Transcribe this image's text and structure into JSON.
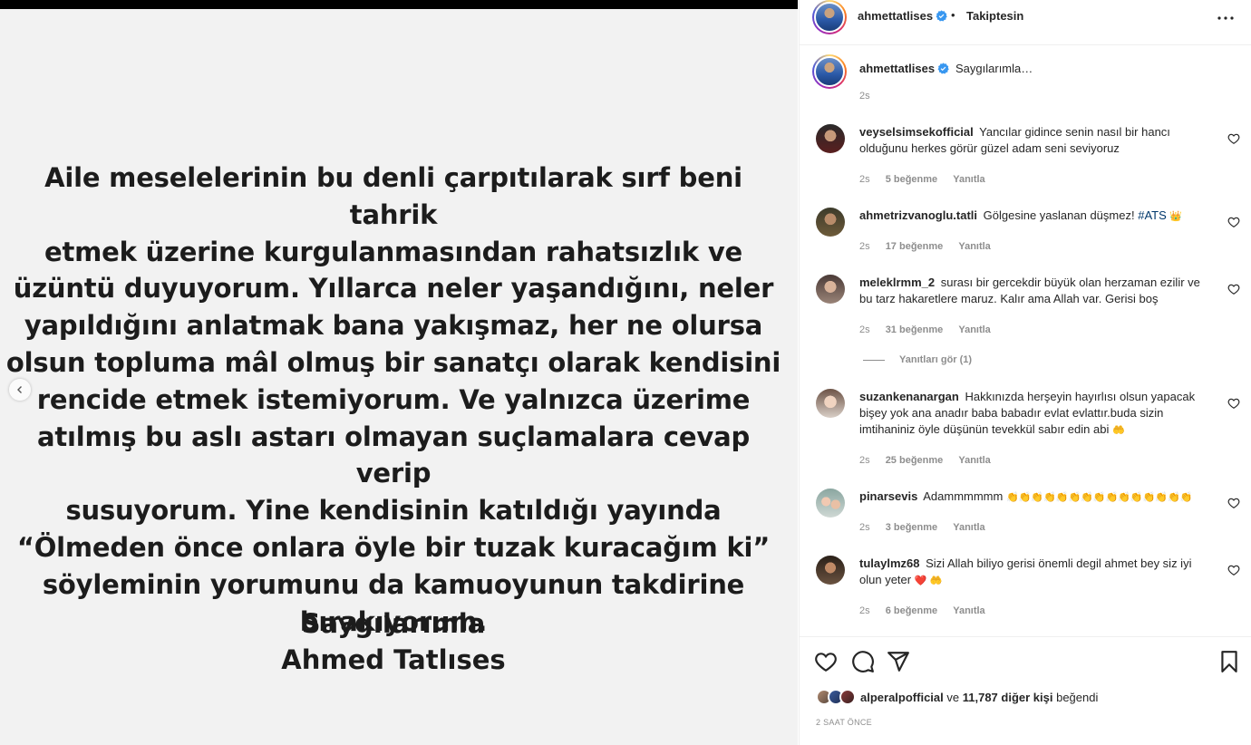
{
  "post": {
    "text_lines": [
      "Aile meselelerinin bu denli çarpıtılarak sırf beni tahrik",
      "etmek üzerine kurgulanmasından rahatsızlık ve",
      "üzüntü duyuyorum. Yıllarca neler yaşandığını, neler",
      "yapıldığını anlatmak bana yakışmaz, her ne olursa",
      "olsun topluma mâl olmuş bir sanatçı olarak kendisini",
      "rencide etmek istemiyorum. Ve yalnızca üzerime",
      "atılmış bu aslı astarı olmayan suçlamalara cevap verip",
      "susuyorum. Yine kendisinin katıldığı yayında",
      "“Ölmeden önce onlara öyle bir tuzak kuracağım ki”",
      "söyleminin yorumunu da kamuoyunun takdirine",
      "bırakıyorum."
    ],
    "sign_1": "Saygılarımla",
    "sign_2": "Ahmed Tatlıses"
  },
  "header": {
    "username": "ahmettatlises",
    "dot": "•",
    "follow_status": "Takiptesin"
  },
  "caption": {
    "username": "ahmettatlises",
    "text": "Saygılarımla…",
    "time": "2s"
  },
  "comments": [
    {
      "user": "veyselsimsekofficial",
      "text": "Yancılar gidince senin nasıl bir hancı olduğunu herkes görür güzel adam seni seviyoruz",
      "time": "2s",
      "likes": "5 beğenme",
      "reply": "Yanıtla"
    },
    {
      "user": "ahmetrizvanoglu.tatli",
      "text": "Gölgesine yaslanan düşmez!",
      "tag": "#ATS",
      "emoji": "👑",
      "time": "2s",
      "likes": "17 beğenme",
      "reply": "Yanıtla"
    },
    {
      "user": "meleklrmm_2",
      "text": "surası bir gercekdir büyük olan herzaman ezilir ve bu tarz hakaretlere maruz. Kalır ama Allah var. Gerisi boş",
      "time": "2s",
      "likes": "31 beğenme",
      "reply": "Yanıtla",
      "view_replies": "Yanıtları gör (1)"
    },
    {
      "user": "suzankenanargan",
      "text": "Hakkınızda herşeyin hayırlısı olsun yapacak bişey yok ana anadır baba babadır evlat evlattır.buda sizin imtihaniniz öyle düşünün tevekkül sabır edin abi",
      "emoji": "🤲",
      "time": "2s",
      "likes": "25 beğenme",
      "reply": "Yanıtla"
    },
    {
      "user": "pinarsevis",
      "text": "Adammmmmm",
      "emoji": "👏👏👏👏👏👏👏👏👏👏👏👏👏👏👏",
      "time": "2s",
      "likes": "3 beğenme",
      "reply": "Yanıtla"
    },
    {
      "user": "tulaylmz68",
      "text": "Sizi Allah biliyo gerisi önemli degil ahmet bey siz iyi olun yeter",
      "emoji": "❤️ 🤲",
      "time": "2s",
      "likes": "6 beğenme",
      "reply": "Yanıtla"
    }
  ],
  "footer": {
    "liked_by_user": "alperalpofficial",
    "liked_by_and": "ve",
    "liked_by_others": "11,787 diğer kişi",
    "liked_by_suffix": "beğendi",
    "post_time": "2 SAAT ÖNCE"
  },
  "icons": {
    "verified": "verified-badge-icon",
    "more": "more-horizontal-icon",
    "heart": "heart-icon",
    "comment": "comment-icon",
    "share": "share-icon",
    "save": "bookmark-icon",
    "prev": "chevron-left-icon"
  },
  "colors": {
    "verified_blue": "#3897f0",
    "link_blue": "#00376b",
    "secondary_text": "#8e8e8e",
    "border": "#efefef"
  }
}
